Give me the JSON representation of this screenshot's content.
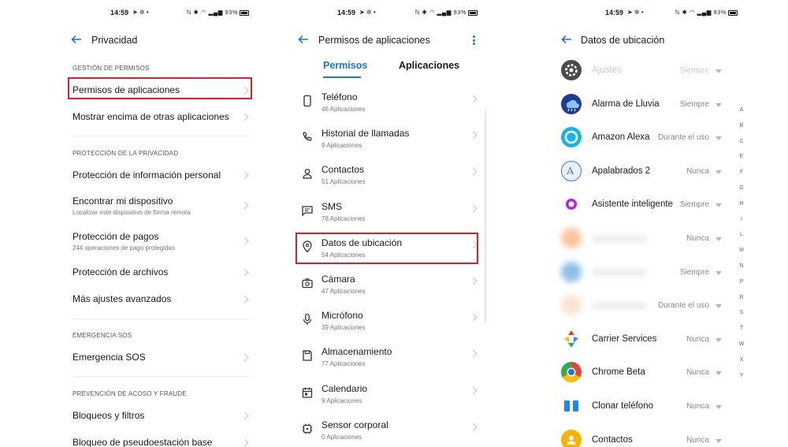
{
  "status": {
    "screen1_time": "14:59",
    "screen2_time": "14:59",
    "screen3_time": "14:59",
    "battery": "93%"
  },
  "screen1": {
    "title": "Privacidad",
    "sections": [
      {
        "header": "GESTIÓN DE PERMISOS",
        "items": [
          {
            "label": "Permisos de aplicaciones",
            "sub": ""
          },
          {
            "label": "Mostrar encima de otras aplicaciones",
            "sub": ""
          }
        ]
      },
      {
        "header": "PROTECCIÓN DE LA PRIVACIDAD",
        "items": [
          {
            "label": "Protección de información personal",
            "sub": ""
          },
          {
            "label": "Encontrar mi dispositivo",
            "sub": "Localizar este dispositivo de forma remota"
          },
          {
            "label": "Protección de pagos",
            "sub": "244 operaciones de pago protegidas"
          },
          {
            "label": "Protección de archivos",
            "sub": ""
          },
          {
            "label": "Más ajustes avanzados",
            "sub": ""
          }
        ]
      },
      {
        "header": "EMERGENCIA SOS",
        "items": [
          {
            "label": "Emergencia SOS",
            "sub": ""
          }
        ]
      },
      {
        "header": "PREVENCIÓN DE ACOSO Y FRAUDE",
        "items": [
          {
            "label": "Bloqueos y filtros",
            "sub": ""
          },
          {
            "label": "Bloqueo de pseudoestación base",
            "sub": ""
          }
        ]
      }
    ]
  },
  "screen2": {
    "title": "Permisos de aplicaciones",
    "tabs": [
      "Permisos",
      "Aplicaciones"
    ],
    "items": [
      {
        "label": "Teléfono",
        "sub": "46 Aplicaciones",
        "icon": "phone-icon"
      },
      {
        "label": "Historial de llamadas",
        "sub": "9 Aplicaciones",
        "icon": "call-log-icon"
      },
      {
        "label": "Contactos",
        "sub": "51 Aplicaciones",
        "icon": "contacts-icon"
      },
      {
        "label": "SMS",
        "sub": "78 Aplicaciones",
        "icon": "sms-icon"
      },
      {
        "label": "Datos de ubicación",
        "sub": "54 Aplicaciones",
        "icon": "location-icon"
      },
      {
        "label": "Cámara",
        "sub": "47 Aplicaciones",
        "icon": "camera-icon"
      },
      {
        "label": "Micrófono",
        "sub": "39 Aplicaciones",
        "icon": "microphone-icon"
      },
      {
        "label": "Almacenamiento",
        "sub": "77 Aplicaciones",
        "icon": "storage-icon"
      },
      {
        "label": "Calendario",
        "sub": "9 Aplicaciones",
        "icon": "calendar-icon"
      },
      {
        "label": "Sensor corporal",
        "sub": "0 Aplicaciones",
        "icon": "body-sensor-icon"
      }
    ]
  },
  "screen3": {
    "title": "Datos de ubicación",
    "apps": [
      {
        "name": "Ajustes",
        "value": "Siempre",
        "icon": "settings-app-icon",
        "color": "#555555",
        "faded": true
      },
      {
        "name": "Alarma de Lluvia",
        "value": "Siempre",
        "icon": "rain-alarm-app-icon",
        "color": "#1f3a93"
      },
      {
        "name": "Amazon Alexa",
        "value": "Durante el uso",
        "icon": "alexa-app-icon",
        "color": "#18b4e6"
      },
      {
        "name": "Apalabrados 2",
        "value": "Nunca",
        "icon": "apalabrados-app-icon",
        "color": "#3b7dd8"
      },
      {
        "name": "Asistente inteligente",
        "value": "Siempre",
        "icon": "assistant-app-icon",
        "color": "#9b3dd6"
      },
      {
        "name": "",
        "value": "Nunca",
        "icon": "blurred-app-icon",
        "color": "#f7b07a",
        "blurred": true
      },
      {
        "name": "",
        "value": "Siempre",
        "icon": "blurred-app-icon",
        "color": "#6aa9e0",
        "blurred": true
      },
      {
        "name": "",
        "value": "Durante el uso",
        "icon": "blurred-app-icon",
        "color": "#f6dcc4",
        "blurred": true
      },
      {
        "name": "Carrier Services",
        "value": "Nunca",
        "icon": "carrier-services-app-icon",
        "color": "#34a853"
      },
      {
        "name": "Chrome Beta",
        "value": "Nunca",
        "icon": "chrome-beta-app-icon",
        "color": "#1a73e8"
      },
      {
        "name": "Clonar teléfono",
        "value": "Nunca",
        "icon": "clone-phone-app-icon",
        "color": "#1e88e5"
      },
      {
        "name": "Contactos",
        "value": "Nunca",
        "icon": "contacts-app-icon",
        "color": "#f5b400"
      }
    ],
    "index_letters": [
      "A",
      "B",
      "C",
      "E",
      "F",
      "G",
      "H",
      "I",
      "L",
      "M",
      "N",
      "P",
      "R",
      "S",
      "T",
      "W",
      "X",
      "Y"
    ]
  },
  "colors": {
    "accent": "#1a73e8",
    "highlight": "#e02020"
  }
}
